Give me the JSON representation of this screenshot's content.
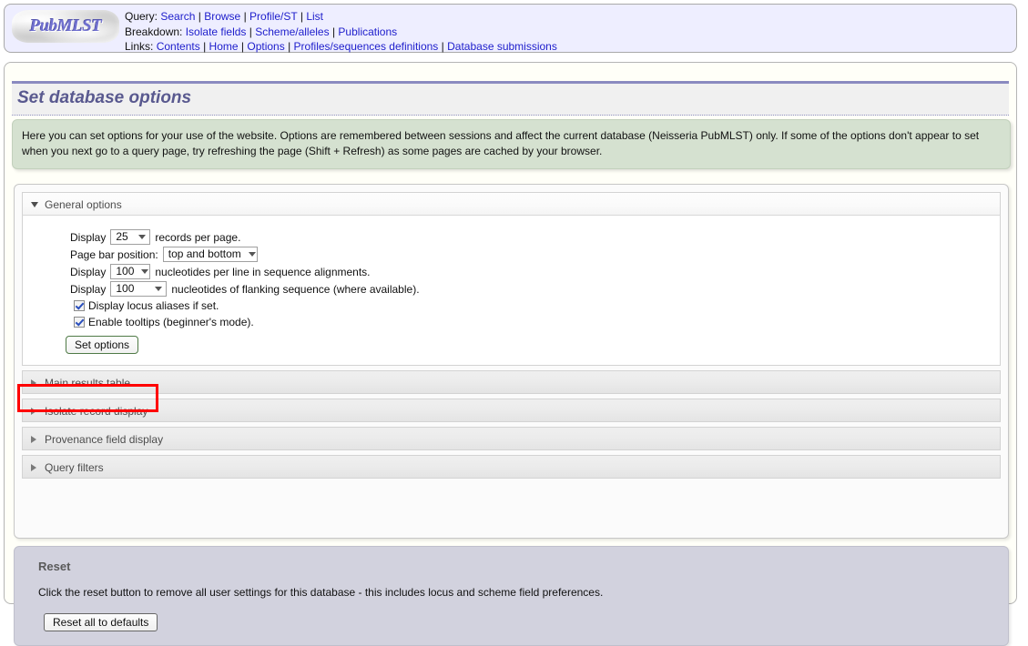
{
  "header": {
    "logo_text": "PubMLST",
    "nav_rows": [
      {
        "label": "Query:",
        "links": [
          "Search",
          "Browse",
          "Profile/ST",
          "List"
        ]
      },
      {
        "label": "Breakdown:",
        "links": [
          "Isolate fields",
          "Scheme/alleles",
          "Publications"
        ]
      },
      {
        "label": "Links:",
        "links": [
          "Contents",
          "Home",
          "Options",
          "Profiles/sequences definitions",
          "Database submissions"
        ]
      }
    ]
  },
  "page": {
    "title": "Set database options",
    "info_text": "Here you can set options for your use of the website. Options are remembered between sessions and affect the current database (Neisseria PubMLST) only. If some of the options don't appear to set when you next go to a query page, try refreshing the page (Shift + Refresh) as some pages are cached by your browser."
  },
  "general_options": {
    "header_label": "General options",
    "rows": [
      {
        "prefix": "Display",
        "value": "25",
        "suffix": "records per page."
      },
      {
        "prefix": "Page bar position:",
        "value": "top and bottom",
        "suffix": ""
      },
      {
        "prefix": "Display",
        "value": "100",
        "suffix": "nucleotides per line in sequence alignments."
      },
      {
        "prefix": "Display",
        "value": "100",
        "suffix": "nucleotides of flanking sequence (where available)."
      }
    ],
    "checkboxes": [
      {
        "label": "Display locus aliases if set.",
        "checked": true
      },
      {
        "label": "Enable tooltips (beginner's mode).",
        "checked": true
      }
    ],
    "submit_label": "Set options"
  },
  "collapsed_sections": [
    {
      "label": "Main results table",
      "highlighted": false
    },
    {
      "label": "Isolate record display",
      "highlighted": true
    },
    {
      "label": "Provenance field display",
      "highlighted": false
    },
    {
      "label": "Query filters",
      "highlighted": false
    }
  ],
  "reset": {
    "title": "Reset",
    "description": "Click the reset button to remove all user settings for this database - this includes locus and scheme field preferences.",
    "button_label": "Reset all to defaults"
  },
  "colors": {
    "highlight_box": "#ff0000",
    "header_bg": "#eeeeff",
    "info_bg": "#d5e1d0",
    "reset_bg": "#d2d2de",
    "title_color": "#59598f",
    "link_color": "#2020cc"
  }
}
